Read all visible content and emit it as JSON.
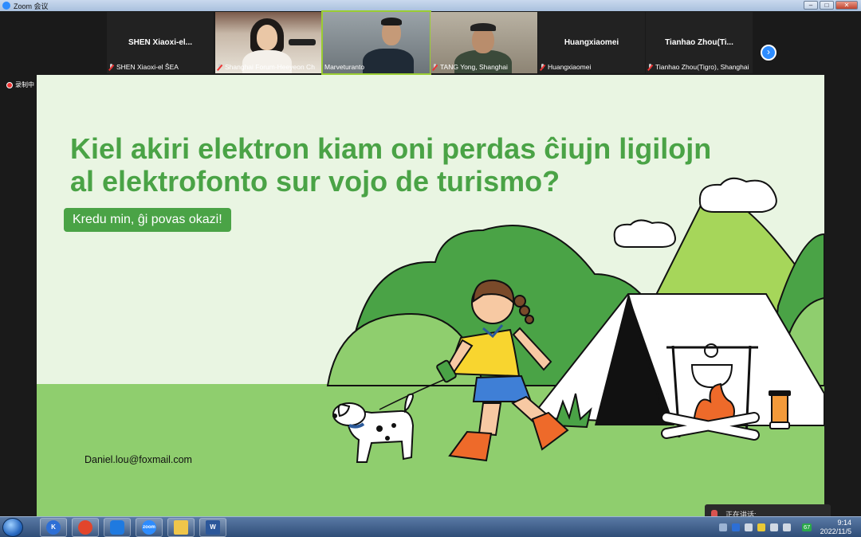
{
  "window": {
    "title": "Zoom 会议",
    "minimize": "–",
    "maximize": "□",
    "close": "✕"
  },
  "participants": [
    {
      "display_name": "SHEN  Xiaoxi-el...",
      "label": "SHEN Xiaoxi-el ŜEA",
      "video": false,
      "muted": true
    },
    {
      "display_name": "",
      "label": "Shanghai Forum-Heeyeon Ch",
      "video": true,
      "muted": true
    },
    {
      "display_name": "",
      "label": "Marveturanto",
      "video": true,
      "muted": false,
      "speaking": true
    },
    {
      "display_name": "",
      "label": "TANG Yong, Shanghai",
      "video": true,
      "muted": true
    },
    {
      "display_name": "Huangxiaomei",
      "label": "Huangxiaomei",
      "video": false,
      "muted": true
    },
    {
      "display_name": "Tianhao  Zhou(Ti...",
      "label": "Tianhao Zhou(Tigro), Shanghai",
      "video": false,
      "muted": true
    }
  ],
  "next_page_icon": "chevron-right-icon",
  "recording": {
    "label": "录制中"
  },
  "slide": {
    "title": "Kiel akiri elektron kiam oni perdas ĉiujn ligilojn al elektrofonto sur vojo de turismo?",
    "button": "Kredu min, ĝi povas okazi!",
    "email": "Daniel.lou@foxmail.com",
    "accent_color": "#4aa346",
    "background_color": "#e9f5e2"
  },
  "speaking_popup": {
    "label": "正在讲话:"
  },
  "taskbar": {
    "apps": [
      "kuaiwen-app-icon",
      "browser-app-icon",
      "meeting-app-icon",
      "zoom-app-icon",
      "explorer-app-icon",
      "word-app-icon"
    ],
    "zoom_app_label": "zoom",
    "word_app_label": "W",
    "tray_badge": "67",
    "time": "9:14",
    "date": "2022/11/5"
  }
}
